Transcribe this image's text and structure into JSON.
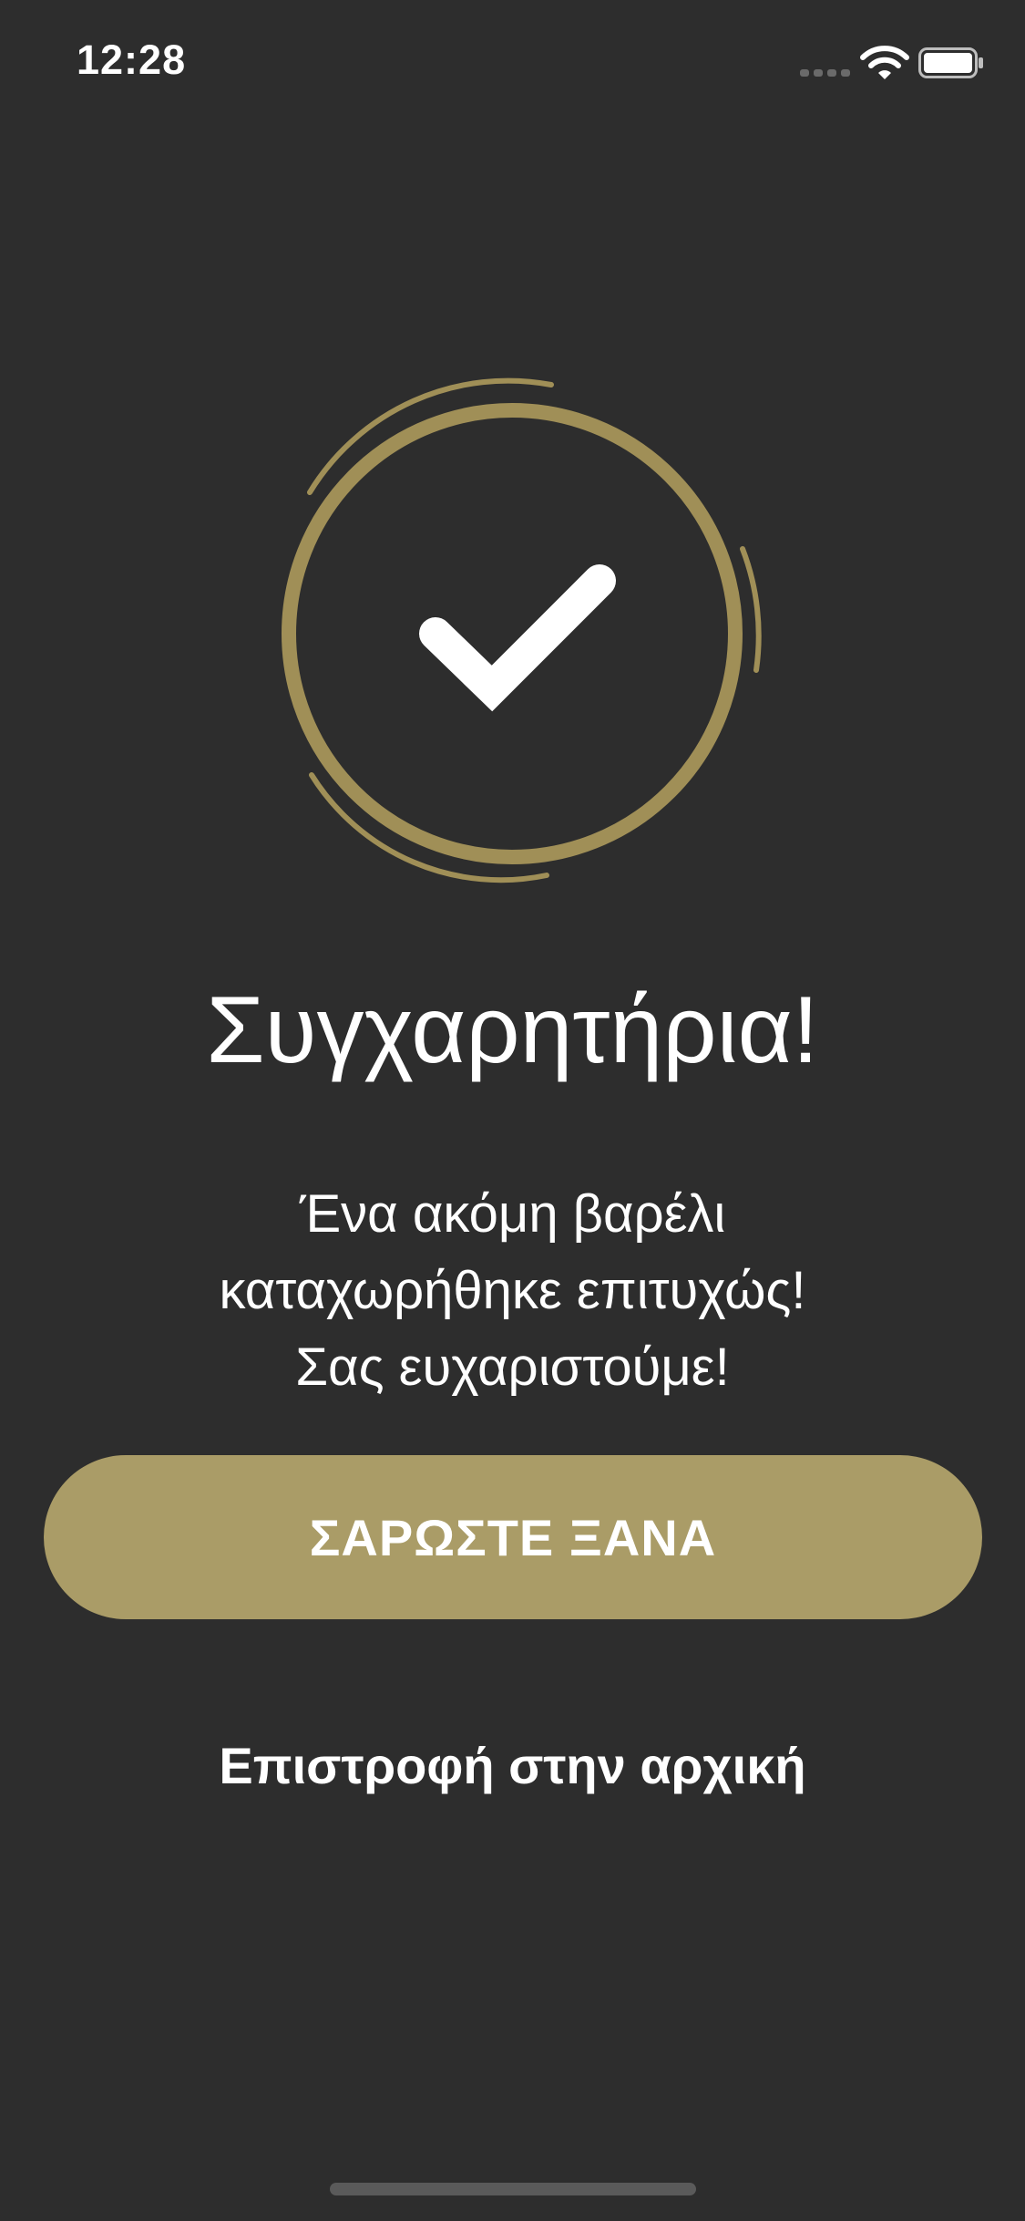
{
  "status_bar": {
    "time": "12:28",
    "icons": [
      "signal-icon",
      "wifi-icon",
      "battery-icon"
    ]
  },
  "colors": {
    "background": "#2d2d2d",
    "accent": "#aa9c67",
    "ring": "#a08f57",
    "text": "#ffffff"
  },
  "success_icon": {
    "icon": "checkmark-icon"
  },
  "title": "Συγχαρητήρια!",
  "message": {
    "line1": "Ένα ακόμη βαρέλι",
    "line2": "καταχωρήθηκε επιτυχώς!",
    "line3": "Σας ευχαριστούμε!"
  },
  "actions": {
    "scan_again_label": "ΣΑΡΩΣΤΕ ΞΑΝΑ",
    "home_label": "Επιστροφή στην αρχική"
  }
}
